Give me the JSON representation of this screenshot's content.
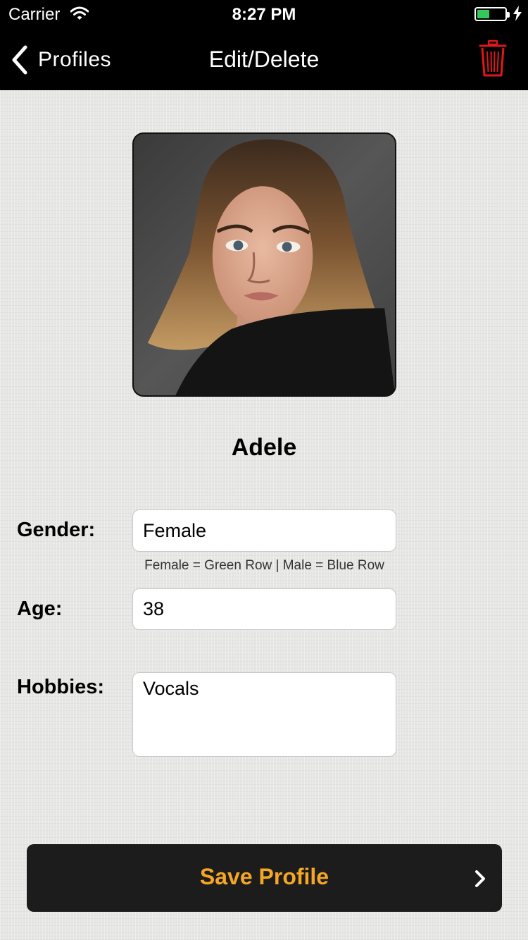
{
  "status_bar": {
    "carrier": "Carrier",
    "time": "8:27 PM",
    "battery_level": 0.45,
    "battery_color": "#34c759"
  },
  "nav": {
    "back_label": "Profiles",
    "title": "Edit/Delete",
    "delete_icon": "trash-icon",
    "delete_icon_color": "#e0181a"
  },
  "profile": {
    "name": "Adele"
  },
  "form": {
    "gender_label": "Gender:",
    "gender_value": "Female",
    "gender_hint": "Female = Green Row | Male = Blue Row",
    "age_label": "Age:",
    "age_value": "38",
    "hobbies_label": "Hobbies:",
    "hobbies_value": "Vocals"
  },
  "save_button": {
    "label": "Save Profile",
    "label_color": "#f5a623",
    "icon": "chevron-right-icon"
  }
}
